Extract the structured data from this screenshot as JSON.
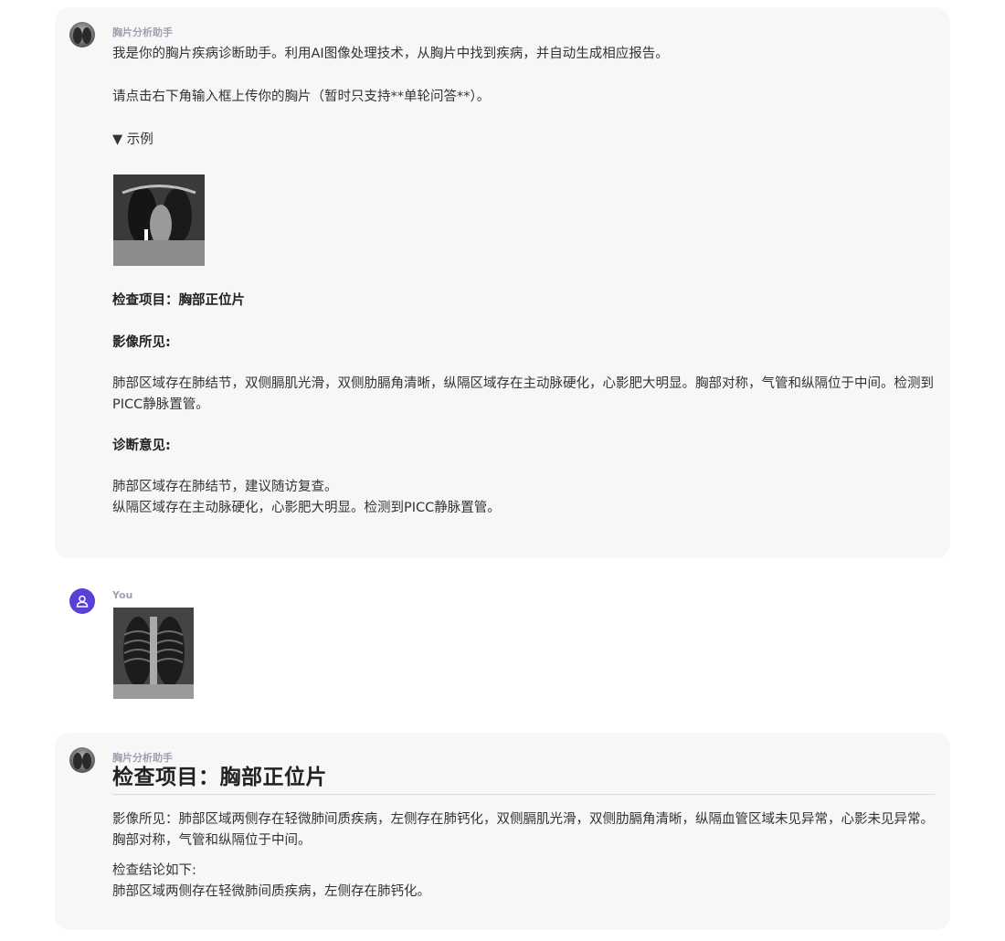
{
  "assistant_name": "胸片分析助手",
  "user_name": "You",
  "intro": {
    "line1": "我是你的胸片疾病诊断助手。利用AI图像处理技术，从胸片中找到疾病，并自动生成相应报告。",
    "line2": "请点击右下角输入框上传你的胸片（暂时只支持**单轮问答**）。",
    "example_toggle": "▼ 示例",
    "exam_item": "检查项目：胸部正位片",
    "findings_label": "影像所见:",
    "findings_text": "肺部区域存在肺结节，双侧膈肌光滑，双侧肋膈角清晰，纵隔区域存在主动脉硬化，心影肥大明显。胸部对称，气管和纵隔位于中间。检测到PICC静脉置管。",
    "diagnosis_label": "诊断意见:",
    "diagnosis_line1": "肺部区域存在肺结节，建议随访复查。",
    "diagnosis_line2": "纵隔区域存在主动脉硬化，心影肥大明显。检测到PICC静脉置管。"
  },
  "report": {
    "title": "检查项目：胸部正位片",
    "findings": "影像所见：肺部区域两侧存在轻微肺间质疾病，左侧存在肺钙化，双侧膈肌光滑，双侧肋膈角清晰，纵隔血管区域未见异常，心影未见异常。胸部对称，气管和纵隔位于中间。",
    "conclusion_label": "检查结论如下:",
    "conclusion_text": "肺部区域两侧存在轻微肺间质疾病，左侧存在肺钙化。"
  }
}
